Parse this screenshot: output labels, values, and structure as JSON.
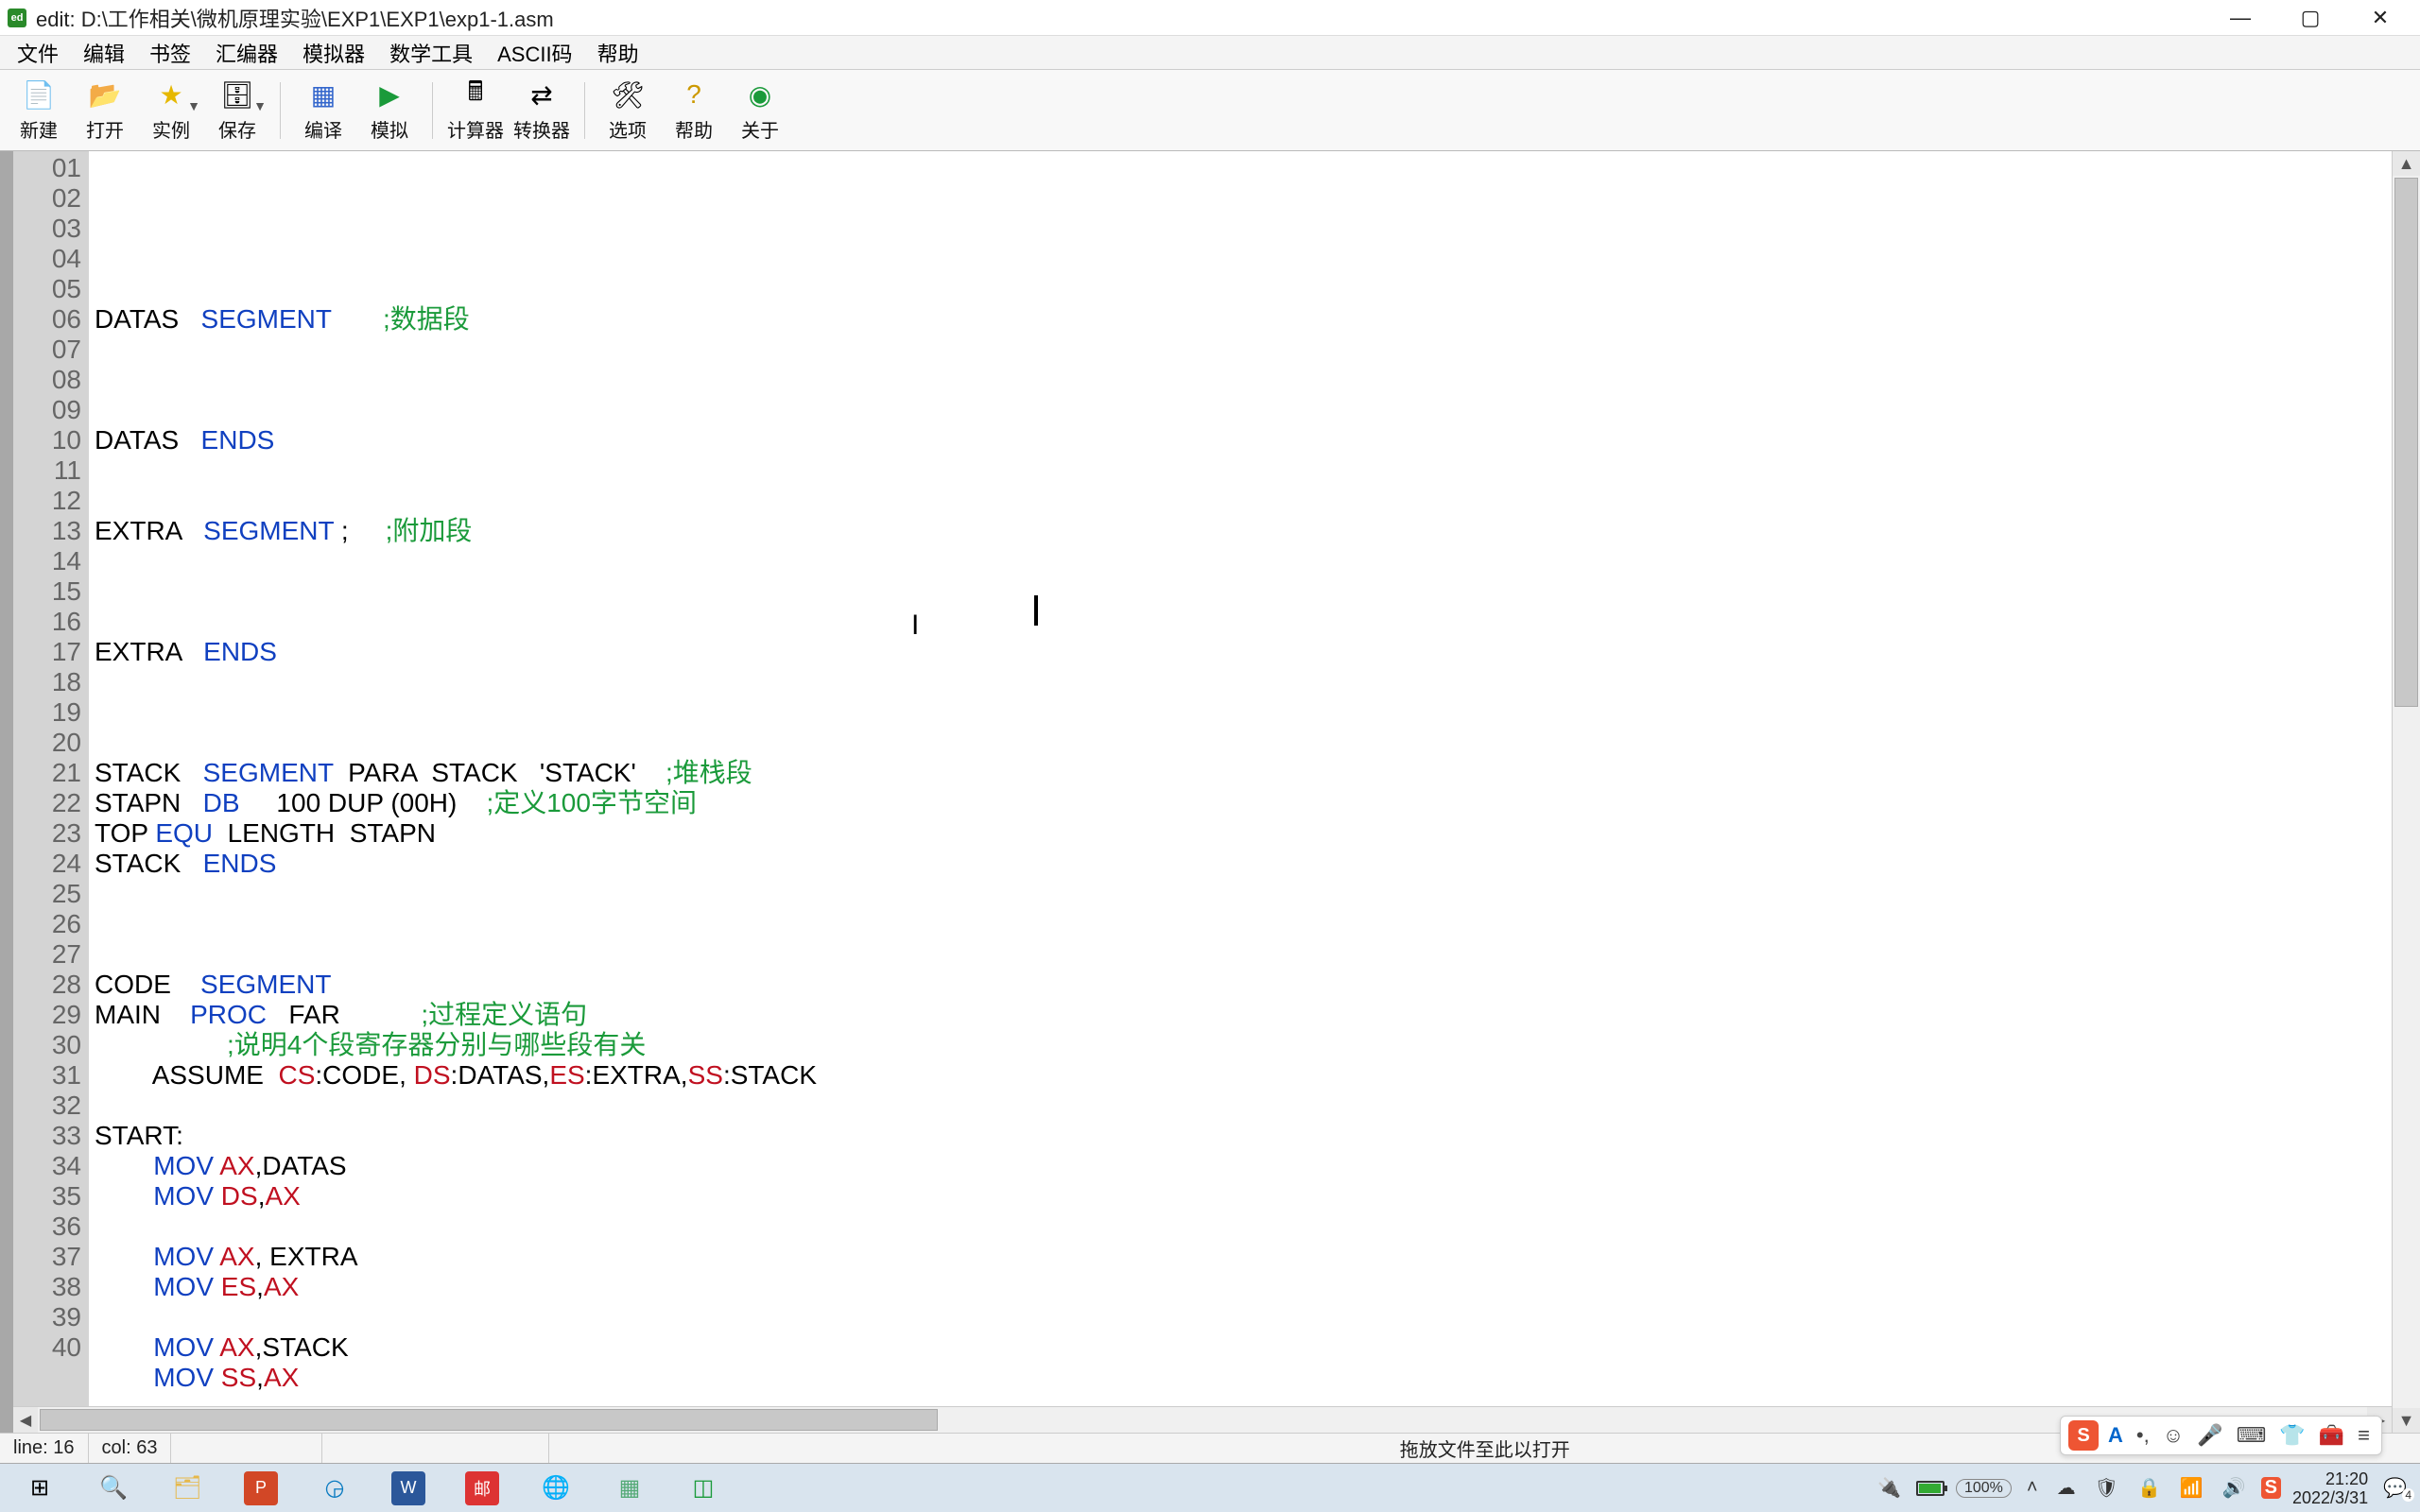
{
  "title": "edit: D:\\工作相关\\微机原理实验\\EXP1\\EXP1\\exp1-1.asm",
  "menu": [
    "文件",
    "编辑",
    "书签",
    "汇编器",
    "模拟器",
    "数学工具",
    "ASCII码",
    "帮助"
  ],
  "toolbar": [
    {
      "label": "新建",
      "glyph": "📄",
      "drop": false
    },
    {
      "label": "打开",
      "glyph": "📂",
      "drop": false
    },
    {
      "label": "实例",
      "glyph": "★",
      "drop": true,
      "color": "#e6b800"
    },
    {
      "label": "保存",
      "glyph": "🗄",
      "drop": true
    },
    {
      "sep": true
    },
    {
      "label": "编译",
      "glyph": "▦",
      "drop": false,
      "color": "#3366cc"
    },
    {
      "label": "模拟",
      "glyph": "▶",
      "drop": false,
      "color": "#1a9a3a"
    },
    {
      "sep": true
    },
    {
      "label": "计算器",
      "glyph": "🖩",
      "drop": false
    },
    {
      "label": "转换器",
      "glyph": "⇄",
      "drop": false
    },
    {
      "sep": true
    },
    {
      "label": "选项",
      "glyph": "🛠",
      "drop": false
    },
    {
      "label": "帮助",
      "glyph": "?",
      "drop": false,
      "color": "#cc9900"
    },
    {
      "label": "关于",
      "glyph": "◉",
      "drop": false,
      "color": "#1a9a3a"
    }
  ],
  "code_lines": [
    {
      "n": "01",
      "tokens": []
    },
    {
      "n": "02",
      "tokens": [
        {
          "t": "DATAS   ",
          "c": "ident"
        },
        {
          "t": "SEGMENT",
          "c": "kw-blue"
        },
        {
          "t": "       ",
          "c": "ident"
        },
        {
          "t": ";数据段",
          "c": "cmt"
        }
      ]
    },
    {
      "n": "03",
      "tokens": []
    },
    {
      "n": "04",
      "tokens": []
    },
    {
      "n": "05",
      "tokens": []
    },
    {
      "n": "06",
      "tokens": [
        {
          "t": "DATAS   ",
          "c": "ident"
        },
        {
          "t": "ENDS",
          "c": "kw-blue"
        }
      ]
    },
    {
      "n": "07",
      "tokens": []
    },
    {
      "n": "08",
      "tokens": []
    },
    {
      "n": "09",
      "tokens": [
        {
          "t": "EXTRA   ",
          "c": "ident"
        },
        {
          "t": "SEGMENT",
          "c": "kw-blue"
        },
        {
          "t": " ;     ",
          "c": "ident"
        },
        {
          "t": ";附加段",
          "c": "cmt"
        }
      ]
    },
    {
      "n": "10",
      "tokens": []
    },
    {
      "n": "11",
      "tokens": []
    },
    {
      "n": "12",
      "tokens": []
    },
    {
      "n": "13",
      "tokens": [
        {
          "t": "EXTRA   ",
          "c": "ident"
        },
        {
          "t": "ENDS",
          "c": "kw-blue"
        }
      ]
    },
    {
      "n": "14",
      "tokens": []
    },
    {
      "n": "15",
      "tokens": []
    },
    {
      "n": "16",
      "tokens": []
    },
    {
      "n": "17",
      "tokens": [
        {
          "t": "STACK   ",
          "c": "ident"
        },
        {
          "t": "SEGMENT",
          "c": "kw-blue"
        },
        {
          "t": "  PARA  STACK   'STACK'    ",
          "c": "ident"
        },
        {
          "t": ";堆栈段",
          "c": "cmt"
        }
      ]
    },
    {
      "n": "18",
      "tokens": [
        {
          "t": "STAPN   ",
          "c": "ident"
        },
        {
          "t": "DB",
          "c": "kw-blue"
        },
        {
          "t": "     100 DUP (00H)    ",
          "c": "ident"
        },
        {
          "t": ";定义100字节空间",
          "c": "cmt"
        }
      ]
    },
    {
      "n": "19",
      "tokens": [
        {
          "t": "TOP ",
          "c": "ident"
        },
        {
          "t": "EQU",
          "c": "kw-blue"
        },
        {
          "t": "  LENGTH  STAPN",
          "c": "ident"
        }
      ]
    },
    {
      "n": "20",
      "tokens": [
        {
          "t": "STACK   ",
          "c": "ident"
        },
        {
          "t": "ENDS",
          "c": "kw-blue"
        }
      ]
    },
    {
      "n": "21",
      "tokens": []
    },
    {
      "n": "22",
      "tokens": []
    },
    {
      "n": "23",
      "tokens": []
    },
    {
      "n": "24",
      "tokens": [
        {
          "t": "CODE    ",
          "c": "ident"
        },
        {
          "t": "SEGMENT",
          "c": "kw-blue"
        }
      ]
    },
    {
      "n": "25",
      "tokens": [
        {
          "t": "MAIN    ",
          "c": "ident"
        },
        {
          "t": "PROC",
          "c": "kw-blue"
        },
        {
          "t": "   FAR           ",
          "c": "ident"
        },
        {
          "t": ";过程定义语句",
          "c": "cmt"
        }
      ]
    },
    {
      "n": "26",
      "tokens": [
        {
          "t": "                  ",
          "c": "ident"
        },
        {
          "t": ";说明4个段寄存器分别与哪些段有关",
          "c": "cmt"
        }
      ]
    },
    {
      "n": "27",
      "tokens": [
        {
          "t": "        ASSUME  ",
          "c": "ident"
        },
        {
          "t": "CS",
          "c": "kw-red"
        },
        {
          "t": ":CODE, ",
          "c": "ident"
        },
        {
          "t": "DS",
          "c": "kw-red"
        },
        {
          "t": ":DATAS,",
          "c": "ident"
        },
        {
          "t": "ES",
          "c": "kw-red"
        },
        {
          "t": ":EXTRA,",
          "c": "ident"
        },
        {
          "t": "SS",
          "c": "kw-red"
        },
        {
          "t": ":STACK",
          "c": "ident"
        }
      ]
    },
    {
      "n": "28",
      "tokens": []
    },
    {
      "n": "29",
      "tokens": [
        {
          "t": "START:",
          "c": "ident"
        }
      ]
    },
    {
      "n": "30",
      "tokens": [
        {
          "t": "        ",
          "c": "ident"
        },
        {
          "t": "MOV",
          "c": "kw-blue"
        },
        {
          "t": " ",
          "c": "ident"
        },
        {
          "t": "AX",
          "c": "kw-red"
        },
        {
          "t": ",DATAS",
          "c": "ident"
        }
      ]
    },
    {
      "n": "31",
      "tokens": [
        {
          "t": "        ",
          "c": "ident"
        },
        {
          "t": "MOV",
          "c": "kw-blue"
        },
        {
          "t": " ",
          "c": "ident"
        },
        {
          "t": "DS",
          "c": "kw-red"
        },
        {
          "t": ",",
          "c": "ident"
        },
        {
          "t": "AX",
          "c": "kw-red"
        }
      ]
    },
    {
      "n": "32",
      "tokens": []
    },
    {
      "n": "33",
      "tokens": [
        {
          "t": "        ",
          "c": "ident"
        },
        {
          "t": "MOV",
          "c": "kw-blue"
        },
        {
          "t": " ",
          "c": "ident"
        },
        {
          "t": "AX",
          "c": "kw-red"
        },
        {
          "t": ", EXTRA",
          "c": "ident"
        }
      ]
    },
    {
      "n": "34",
      "tokens": [
        {
          "t": "        ",
          "c": "ident"
        },
        {
          "t": "MOV",
          "c": "kw-blue"
        },
        {
          "t": " ",
          "c": "ident"
        },
        {
          "t": "ES",
          "c": "kw-red"
        },
        {
          "t": ",",
          "c": "ident"
        },
        {
          "t": "AX",
          "c": "kw-red"
        }
      ]
    },
    {
      "n": "35",
      "tokens": []
    },
    {
      "n": "36",
      "tokens": [
        {
          "t": "        ",
          "c": "ident"
        },
        {
          "t": "MOV",
          "c": "kw-blue"
        },
        {
          "t": " ",
          "c": "ident"
        },
        {
          "t": "AX",
          "c": "kw-red"
        },
        {
          "t": ",STACK",
          "c": "ident"
        }
      ]
    },
    {
      "n": "37",
      "tokens": [
        {
          "t": "        ",
          "c": "ident"
        },
        {
          "t": "MOV",
          "c": "kw-blue"
        },
        {
          "t": " ",
          "c": "ident"
        },
        {
          "t": "SS",
          "c": "kw-red"
        },
        {
          "t": ",",
          "c": "ident"
        },
        {
          "t": "AX",
          "c": "kw-red"
        }
      ]
    },
    {
      "n": "38",
      "tokens": []
    },
    {
      "n": "39",
      "tokens": []
    },
    {
      "n": "40",
      "tokens": []
    }
  ],
  "status": {
    "line_label": "line:",
    "line": "16",
    "col_label": "col:",
    "col": "63",
    "drop_hint": "拖放文件至此以打开"
  },
  "tray": {
    "zoom": "100%",
    "time": "21:20",
    "date": "2022/3/31",
    "notif": "4"
  },
  "ime": {
    "logo": "S",
    "letter": "A"
  }
}
